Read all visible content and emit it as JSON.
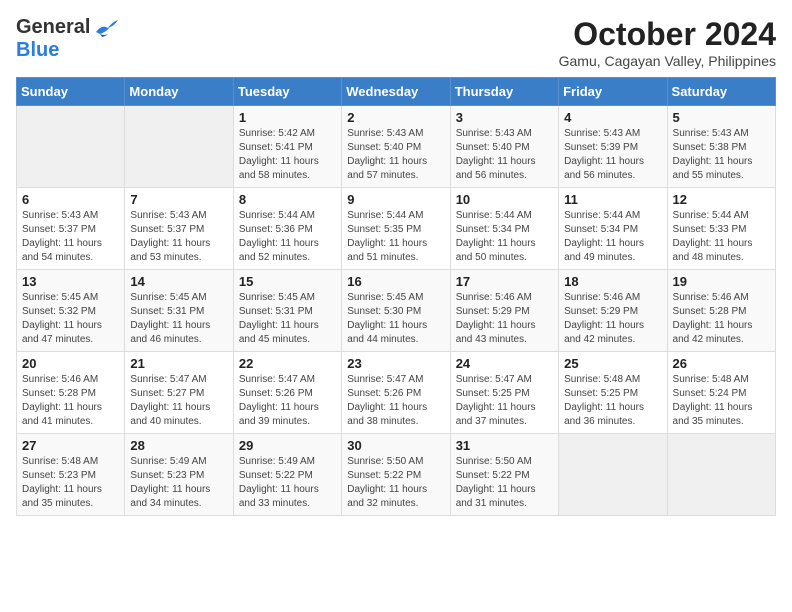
{
  "header": {
    "logo_general": "General",
    "logo_blue": "Blue",
    "month_title": "October 2024",
    "location": "Gamu, Cagayan Valley, Philippines"
  },
  "days_of_week": [
    "Sunday",
    "Monday",
    "Tuesday",
    "Wednesday",
    "Thursday",
    "Friday",
    "Saturday"
  ],
  "weeks": [
    [
      {
        "day": "",
        "info": ""
      },
      {
        "day": "",
        "info": ""
      },
      {
        "day": "1",
        "info": "Sunrise: 5:42 AM\nSunset: 5:41 PM\nDaylight: 11 hours and 58 minutes."
      },
      {
        "day": "2",
        "info": "Sunrise: 5:43 AM\nSunset: 5:40 PM\nDaylight: 11 hours and 57 minutes."
      },
      {
        "day": "3",
        "info": "Sunrise: 5:43 AM\nSunset: 5:40 PM\nDaylight: 11 hours and 56 minutes."
      },
      {
        "day": "4",
        "info": "Sunrise: 5:43 AM\nSunset: 5:39 PM\nDaylight: 11 hours and 56 minutes."
      },
      {
        "day": "5",
        "info": "Sunrise: 5:43 AM\nSunset: 5:38 PM\nDaylight: 11 hours and 55 minutes."
      }
    ],
    [
      {
        "day": "6",
        "info": "Sunrise: 5:43 AM\nSunset: 5:37 PM\nDaylight: 11 hours and 54 minutes."
      },
      {
        "day": "7",
        "info": "Sunrise: 5:43 AM\nSunset: 5:37 PM\nDaylight: 11 hours and 53 minutes."
      },
      {
        "day": "8",
        "info": "Sunrise: 5:44 AM\nSunset: 5:36 PM\nDaylight: 11 hours and 52 minutes."
      },
      {
        "day": "9",
        "info": "Sunrise: 5:44 AM\nSunset: 5:35 PM\nDaylight: 11 hours and 51 minutes."
      },
      {
        "day": "10",
        "info": "Sunrise: 5:44 AM\nSunset: 5:34 PM\nDaylight: 11 hours and 50 minutes."
      },
      {
        "day": "11",
        "info": "Sunrise: 5:44 AM\nSunset: 5:34 PM\nDaylight: 11 hours and 49 minutes."
      },
      {
        "day": "12",
        "info": "Sunrise: 5:44 AM\nSunset: 5:33 PM\nDaylight: 11 hours and 48 minutes."
      }
    ],
    [
      {
        "day": "13",
        "info": "Sunrise: 5:45 AM\nSunset: 5:32 PM\nDaylight: 11 hours and 47 minutes."
      },
      {
        "day": "14",
        "info": "Sunrise: 5:45 AM\nSunset: 5:31 PM\nDaylight: 11 hours and 46 minutes."
      },
      {
        "day": "15",
        "info": "Sunrise: 5:45 AM\nSunset: 5:31 PM\nDaylight: 11 hours and 45 minutes."
      },
      {
        "day": "16",
        "info": "Sunrise: 5:45 AM\nSunset: 5:30 PM\nDaylight: 11 hours and 44 minutes."
      },
      {
        "day": "17",
        "info": "Sunrise: 5:46 AM\nSunset: 5:29 PM\nDaylight: 11 hours and 43 minutes."
      },
      {
        "day": "18",
        "info": "Sunrise: 5:46 AM\nSunset: 5:29 PM\nDaylight: 11 hours and 42 minutes."
      },
      {
        "day": "19",
        "info": "Sunrise: 5:46 AM\nSunset: 5:28 PM\nDaylight: 11 hours and 42 minutes."
      }
    ],
    [
      {
        "day": "20",
        "info": "Sunrise: 5:46 AM\nSunset: 5:28 PM\nDaylight: 11 hours and 41 minutes."
      },
      {
        "day": "21",
        "info": "Sunrise: 5:47 AM\nSunset: 5:27 PM\nDaylight: 11 hours and 40 minutes."
      },
      {
        "day": "22",
        "info": "Sunrise: 5:47 AM\nSunset: 5:26 PM\nDaylight: 11 hours and 39 minutes."
      },
      {
        "day": "23",
        "info": "Sunrise: 5:47 AM\nSunset: 5:26 PM\nDaylight: 11 hours and 38 minutes."
      },
      {
        "day": "24",
        "info": "Sunrise: 5:47 AM\nSunset: 5:25 PM\nDaylight: 11 hours and 37 minutes."
      },
      {
        "day": "25",
        "info": "Sunrise: 5:48 AM\nSunset: 5:25 PM\nDaylight: 11 hours and 36 minutes."
      },
      {
        "day": "26",
        "info": "Sunrise: 5:48 AM\nSunset: 5:24 PM\nDaylight: 11 hours and 35 minutes."
      }
    ],
    [
      {
        "day": "27",
        "info": "Sunrise: 5:48 AM\nSunset: 5:23 PM\nDaylight: 11 hours and 35 minutes."
      },
      {
        "day": "28",
        "info": "Sunrise: 5:49 AM\nSunset: 5:23 PM\nDaylight: 11 hours and 34 minutes."
      },
      {
        "day": "29",
        "info": "Sunrise: 5:49 AM\nSunset: 5:22 PM\nDaylight: 11 hours and 33 minutes."
      },
      {
        "day": "30",
        "info": "Sunrise: 5:50 AM\nSunset: 5:22 PM\nDaylight: 11 hours and 32 minutes."
      },
      {
        "day": "31",
        "info": "Sunrise: 5:50 AM\nSunset: 5:22 PM\nDaylight: 11 hours and 31 minutes."
      },
      {
        "day": "",
        "info": ""
      },
      {
        "day": "",
        "info": ""
      }
    ]
  ]
}
